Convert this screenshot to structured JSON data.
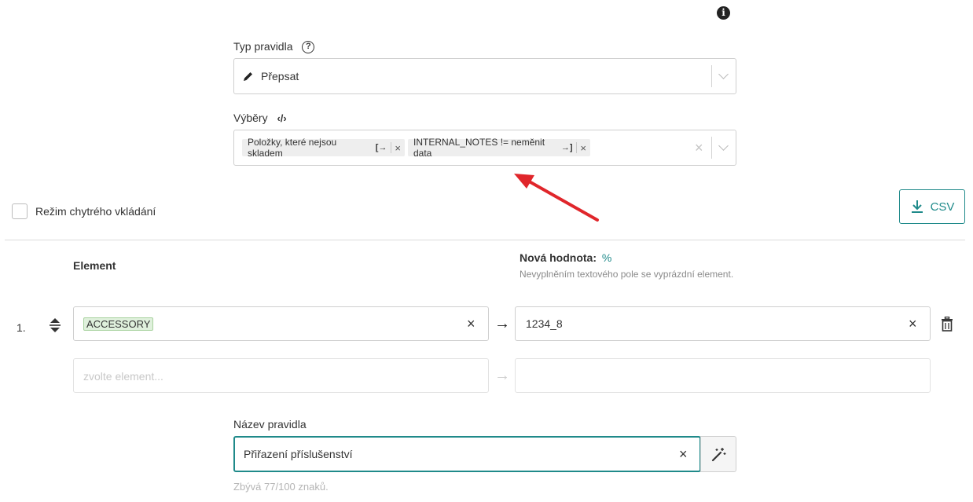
{
  "rule_type": {
    "label": "Typ pravidla",
    "help_icon": "?",
    "value": "Přepsat",
    "value_icon": "pencil-icon"
  },
  "selections": {
    "label": "Výběry",
    "code_icon": "‹/›",
    "tags": [
      {
        "text": "Položky, které nejsou skladem",
        "icon": "[→",
        "remove": "×"
      },
      {
        "text": "INTERNAL_NOTES != neměnit data",
        "icon": "→]",
        "remove": "×"
      }
    ],
    "clear": "×"
  },
  "smart_insert": {
    "label": "Režim chytrého vkládání",
    "checked": false
  },
  "csv_button": {
    "label": "CSV",
    "icon": "download-icon"
  },
  "columns": {
    "element": "Element",
    "new_value": "Nová hodnota:",
    "new_value_symbol": "%",
    "new_value_hint": "Nevyplněním textového pole se vyprázdní element."
  },
  "rows": [
    {
      "index": "1.",
      "element": "ACCESSORY",
      "value": "1234_8"
    }
  ],
  "empty_row": {
    "placeholder": "zvolte element..."
  },
  "rule_name": {
    "label": "Název pravidla",
    "value": "Přiřazení příslušenství",
    "counter": "Zbývá 77/100 znaků."
  },
  "colors": {
    "accent": "#1f8a8a",
    "annotation_arrow": "#e0262b",
    "chip_bg": "#dff0dc"
  }
}
